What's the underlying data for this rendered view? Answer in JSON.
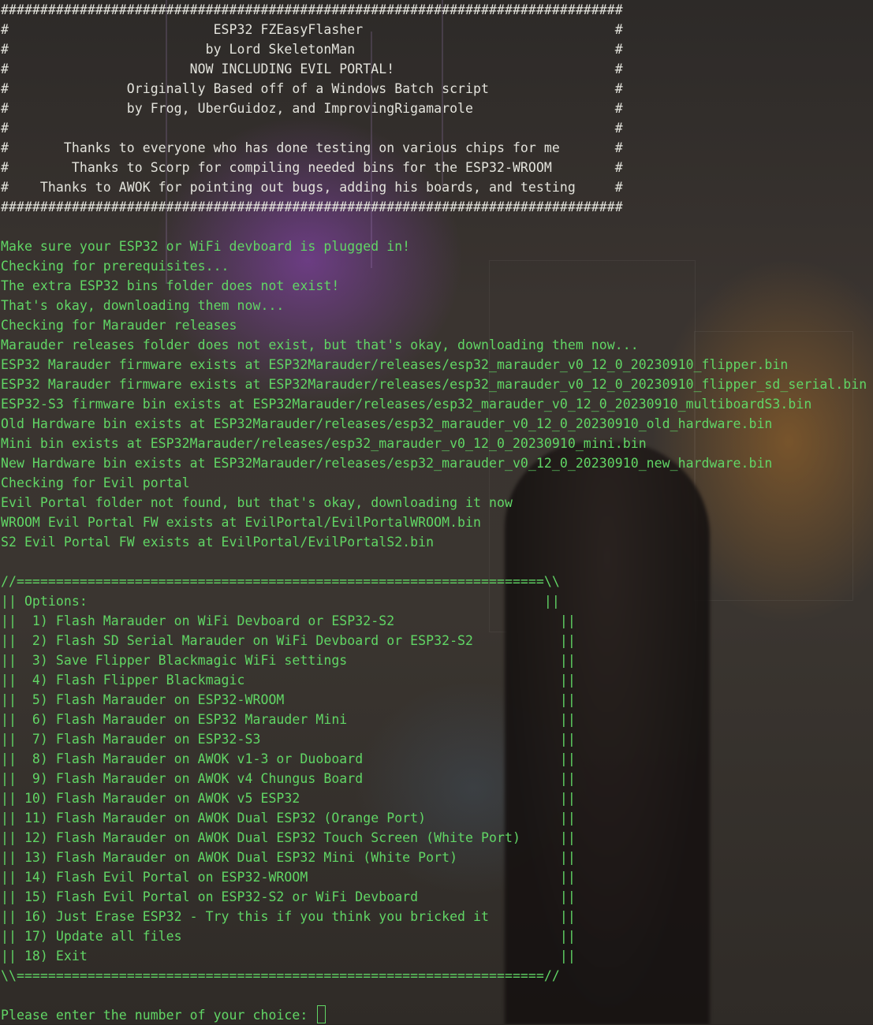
{
  "banner": {
    "lines": [
      "###############################################################################",
      "#                          ESP32 FZEasyFlasher                                #",
      "#                         by Lord SkeletonMan                                 #",
      "#                       NOW INCLUDING EVIL PORTAL!                            #",
      "#               Originally Based off of a Windows Batch script                #",
      "#               by Frog, UberGuidoz, and ImprovingRigamarole                  #",
      "#                                                                             #",
      "#       Thanks to everyone who has done testing on various chips for me       #",
      "#        Thanks to Scorp for compiling needed bins for the ESP32-WROOM        #",
      "#    Thanks to AWOK for pointing out bugs, adding his boards, and testing     #",
      "###############################################################################"
    ]
  },
  "log": {
    "lines": [
      "Make sure your ESP32 or WiFi devboard is plugged in!",
      "Checking for prerequisites...",
      "The extra ESP32 bins folder does not exist!",
      "That's okay, downloading them now...",
      "Checking for Marauder releases",
      "Marauder releases folder does not exist, but that's okay, downloading them now...",
      "ESP32 Marauder firmware exists at ESP32Marauder/releases/esp32_marauder_v0_12_0_20230910_flipper.bin",
      "ESP32 Marauder firmware exists at ESP32Marauder/releases/esp32_marauder_v0_12_0_20230910_flipper_sd_serial.bin",
      "ESP32-S3 firmware bin exists at ESP32Marauder/releases/esp32_marauder_v0_12_0_20230910_multiboardS3.bin",
      "Old Hardware bin exists at ESP32Marauder/releases/esp32_marauder_v0_12_0_20230910_old_hardware.bin",
      "Mini bin exists at ESP32Marauder/releases/esp32_marauder_v0_12_0_20230910_mini.bin",
      "New Hardware bin exists at ESP32Marauder/releases/esp32_marauder_v0_12_0_20230910_new_hardware.bin",
      "Checking for Evil portal",
      "Evil Portal folder not found, but that's okay, downloading it now",
      "WROOM Evil Portal FW exists at EvilPortal/EvilPortalWROOM.bin",
      "S2 Evil Portal FW exists at EvilPortal/EvilPortalS2.bin"
    ]
  },
  "menu": {
    "top_border": "//===================================================================\\\\",
    "title": "|| Options:                                                          ||",
    "items": [
      "||  1) Flash Marauder on WiFi Devboard or ESP32-S2                     ||",
      "||  2) Flash SD Serial Marauder on WiFi Devboard or ESP32-S2           ||",
      "||  3) Save Flipper Blackmagic WiFi settings                           ||",
      "||  4) Flash Flipper Blackmagic                                        ||",
      "||  5) Flash Marauder on ESP32-WROOM                                   ||",
      "||  6) Flash Marauder on ESP32 Marauder Mini                           ||",
      "||  7) Flash Marauder on ESP32-S3                                      ||",
      "||  8) Flash Marauder on AWOK v1-3 or Duoboard                         ||",
      "||  9) Flash Marauder on AWOK v4 Chungus Board                         ||",
      "|| 10) Flash Marauder on AWOK v5 ESP32                                 ||",
      "|| 11) Flash Marauder on AWOK Dual ESP32 (Orange Port)                 ||",
      "|| 12) Flash Marauder on AWOK Dual ESP32 Touch Screen (White Port)     ||",
      "|| 13) Flash Marauder on AWOK Dual ESP32 Mini (White Port)             ||",
      "|| 14) Flash Evil Portal on ESP32-WROOM                                ||",
      "|| 15) Flash Evil Portal on ESP32-S2 or WiFi Devboard                  ||",
      "|| 16) Just Erase ESP32 - Try this if you think you bricked it         ||",
      "|| 17) Update all files                                                ||",
      "|| 18) Exit                                                            ||"
    ],
    "bottom_border": "\\\\===================================================================//"
  },
  "prompt": {
    "text": "Please enter the number of your choice: "
  },
  "colors": {
    "banner_text": "#e3e3dc",
    "terminal_green": "#61d665"
  }
}
